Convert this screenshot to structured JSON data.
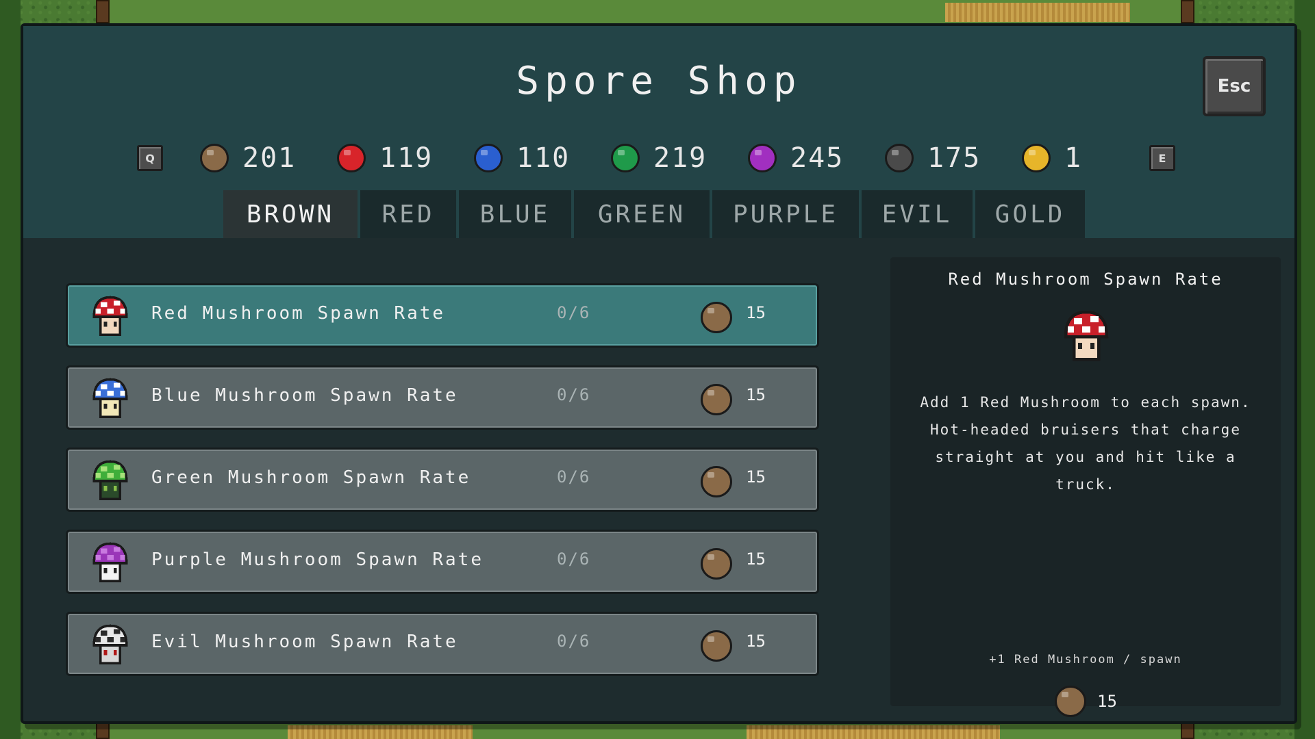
{
  "title": "Spore Shop",
  "esc_label": "Esc",
  "keys": {
    "prev": "Q",
    "next": "E"
  },
  "currencies": [
    {
      "name": "brown-spore",
      "amount": "201",
      "color": "#8a6a48"
    },
    {
      "name": "red-spore",
      "amount": "119",
      "color": "#d8242a"
    },
    {
      "name": "blue-spore",
      "amount": "110",
      "color": "#2a5fd0"
    },
    {
      "name": "green-spore",
      "amount": "219",
      "color": "#1f9a4a"
    },
    {
      "name": "purple-spore",
      "amount": "245",
      "color": "#a12fc0"
    },
    {
      "name": "evil-spore",
      "amount": "175",
      "color": "#4a4a4a"
    },
    {
      "name": "gold-spore",
      "amount": "1",
      "color": "#e7b52a"
    }
  ],
  "tabs": [
    "BROWN",
    "RED",
    "BLUE",
    "GREEN",
    "PURPLE",
    "EVIL",
    "GOLD"
  ],
  "active_tab": "BROWN",
  "items": [
    {
      "name": "Red Mushroom Spawn Rate",
      "level": "0/6",
      "cost": "15",
      "icon": "red-mushroom-icon"
    },
    {
      "name": "Blue Mushroom Spawn Rate",
      "level": "0/6",
      "cost": "15",
      "icon": "blue-mushroom-icon"
    },
    {
      "name": "Green Mushroom Spawn Rate",
      "level": "0/6",
      "cost": "15",
      "icon": "green-mushroom-icon"
    },
    {
      "name": "Purple Mushroom Spawn Rate",
      "level": "0/6",
      "cost": "15",
      "icon": "purple-mushroom-icon"
    },
    {
      "name": "Evil Mushroom Spawn Rate",
      "level": "0/6",
      "cost": "15",
      "icon": "evil-mushroom-icon"
    }
  ],
  "detail": {
    "title": "Red Mushroom Spawn Rate",
    "icon": "red-mushroom-icon",
    "description": "Add 1 Red Mushroom to each spawn. Hot-headed bruisers that charge straight at you and hit like a truck.",
    "effect": "+1 Red Mushroom / spawn",
    "cost": "15"
  },
  "colors": {
    "panel": "#1e2c2e",
    "header": "#234447",
    "selected_row": "#3b7a7a",
    "row": "#5b6668"
  }
}
